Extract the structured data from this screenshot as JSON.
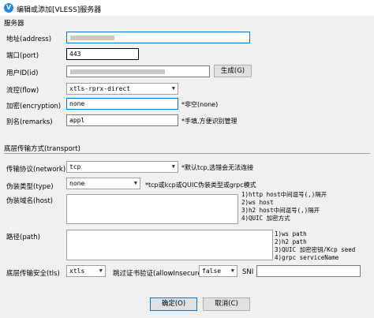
{
  "window": {
    "title": "编辑或添加[VLESS]服务器"
  },
  "server_section": {
    "title": "服务器"
  },
  "fields": {
    "address": {
      "label": "地址(address)",
      "value": ""
    },
    "port": {
      "label": "端口(port)",
      "value": "443"
    },
    "user_id": {
      "label": "用户ID(id)",
      "value": ""
    },
    "generate_button": "生成(G)",
    "flow": {
      "label": "流控(flow)",
      "value": "xtls-rprx-direct"
    },
    "encryption": {
      "label": "加密(encryption)",
      "value": "none",
      "hint": "*非空(none)"
    },
    "remarks": {
      "label": "别名(remarks)",
      "value": "appl",
      "hint": "*手填,方便识别管理"
    }
  },
  "transport_section": {
    "title": "底层传输方式(transport)"
  },
  "transport": {
    "network": {
      "label": "传输协议(network)",
      "value": "tcp",
      "hint": "*默认tcp,选错会无法连接"
    },
    "type": {
      "label": "伪装类型(type)",
      "value": "none",
      "hint": "*tcp或kcp或QUIC伪装类型或grpc模式"
    },
    "host": {
      "label": "伪装域名(host)",
      "help": [
        "1)http host中间逗号(,)隔开",
        "2)ws host",
        "3)h2 host中间逗号(,)隔开",
        "4)QUIC 加密方式"
      ]
    },
    "path": {
      "label": "路径(path)",
      "help": [
        "1)ws path",
        "2)h2 path",
        "3)QUIC 加密密钥/Kcp seed",
        "4)grpc serviceName"
      ]
    },
    "security": {
      "label": "底层传输安全(tls)",
      "value": "xtls"
    },
    "allow_insecure": {
      "label": "跳过证书验证(allowInsecure)",
      "value": "false"
    },
    "sni": {
      "label": "SNI",
      "value": ""
    }
  },
  "buttons": {
    "ok": "确定(O)",
    "cancel": "取消(C)"
  }
}
